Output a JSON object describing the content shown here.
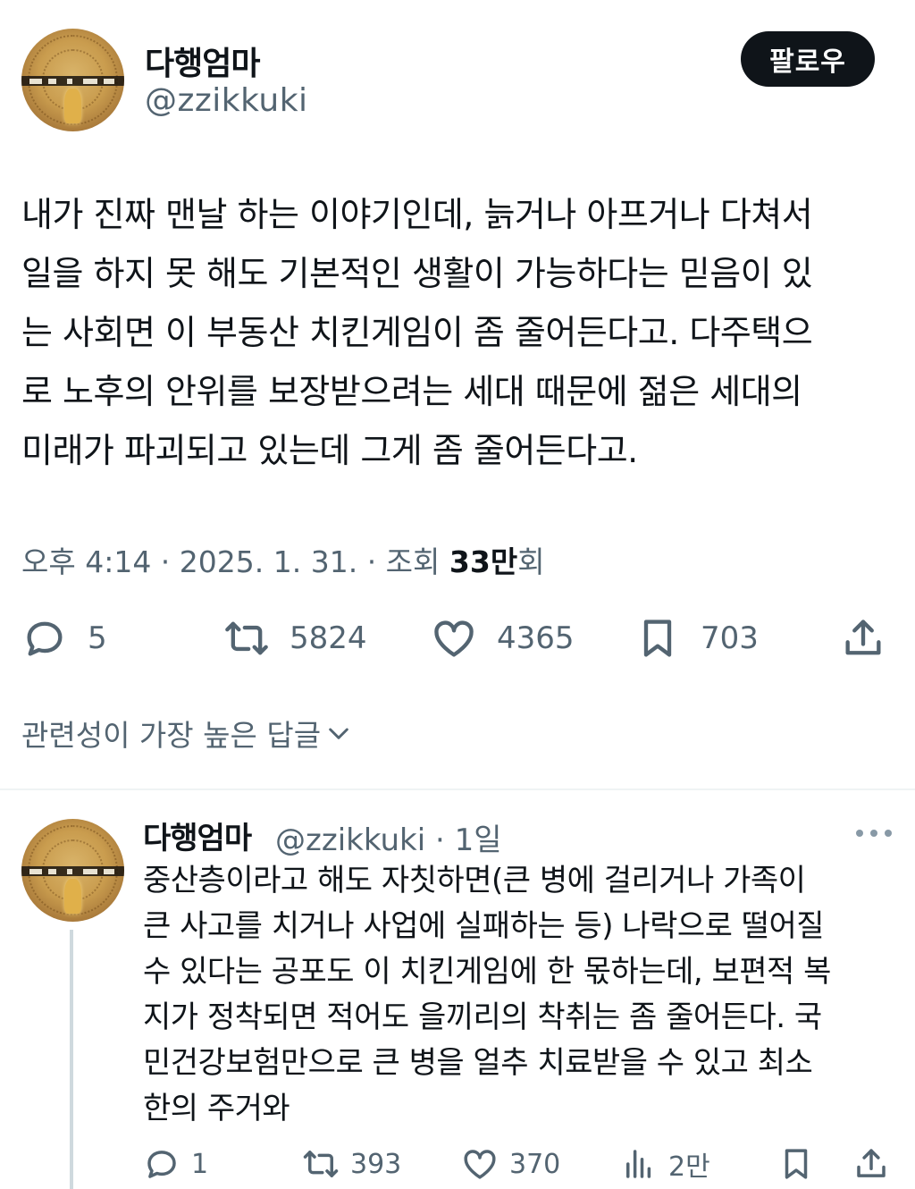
{
  "author": {
    "display_name": "다행엄마",
    "handle": "@zzikkuki"
  },
  "follow_label": "팔로우",
  "tweet": {
    "text": "내가 진짜 맨날 하는 이야기인데, 늙거나 아프거나 다쳐서\n일을 하지 못 해도 기본적인 생활이 가능하다는 믿음이 있\n는 사회면 이 부동산 치킨게임이 좀 줄어든다고. 다주택으\n로 노후의 안위를 보장받으려는 세대 때문에 젊은 세대의\n미래가 파괴되고 있는데 그게 좀 줄어든다고.",
    "time": "오후 4:14 · 2025. 1. 31. · 조회 ",
    "views_count": "33만",
    "views_suffix": "회",
    "stats": {
      "replies": "5",
      "retweets": "5824",
      "likes": "4365",
      "bookmarks": "703"
    }
  },
  "reply_sort_label": "관련성이 가장 높은 답글",
  "reply": {
    "display_name": "다행엄마",
    "handle_time": "@zzikkuki · 1일",
    "text": "중산층이라고 해도 자칫하면(큰 병에 걸리거나 가족이\n큰 사고를 치거나 사업에 실패하는 등) 나락으로 떨어질\n수 있다는 공포도 이 치킨게임에 한 몫하는데, 보편적 복\n지가 정착되면 적어도 을끼리의 착취는 좀 줄어든다. 국\n민건강보험만으로 큰 병을 얼추 치료받을 수 있고 최소\n한의 주거와",
    "stats": {
      "replies": "1",
      "retweets": "393",
      "likes": "370",
      "views": "2만"
    }
  },
  "colors": {
    "text": "#0f1419",
    "secondary": "#536471",
    "button_bg": "#0f1419",
    "divider": "#eff3f4",
    "thread_line": "#cfd9de"
  },
  "icons": [
    "reply-icon",
    "retweet-icon",
    "like-icon",
    "bookmark-icon",
    "share-icon",
    "views-icon",
    "chevron-down-icon",
    "more-icon"
  ]
}
